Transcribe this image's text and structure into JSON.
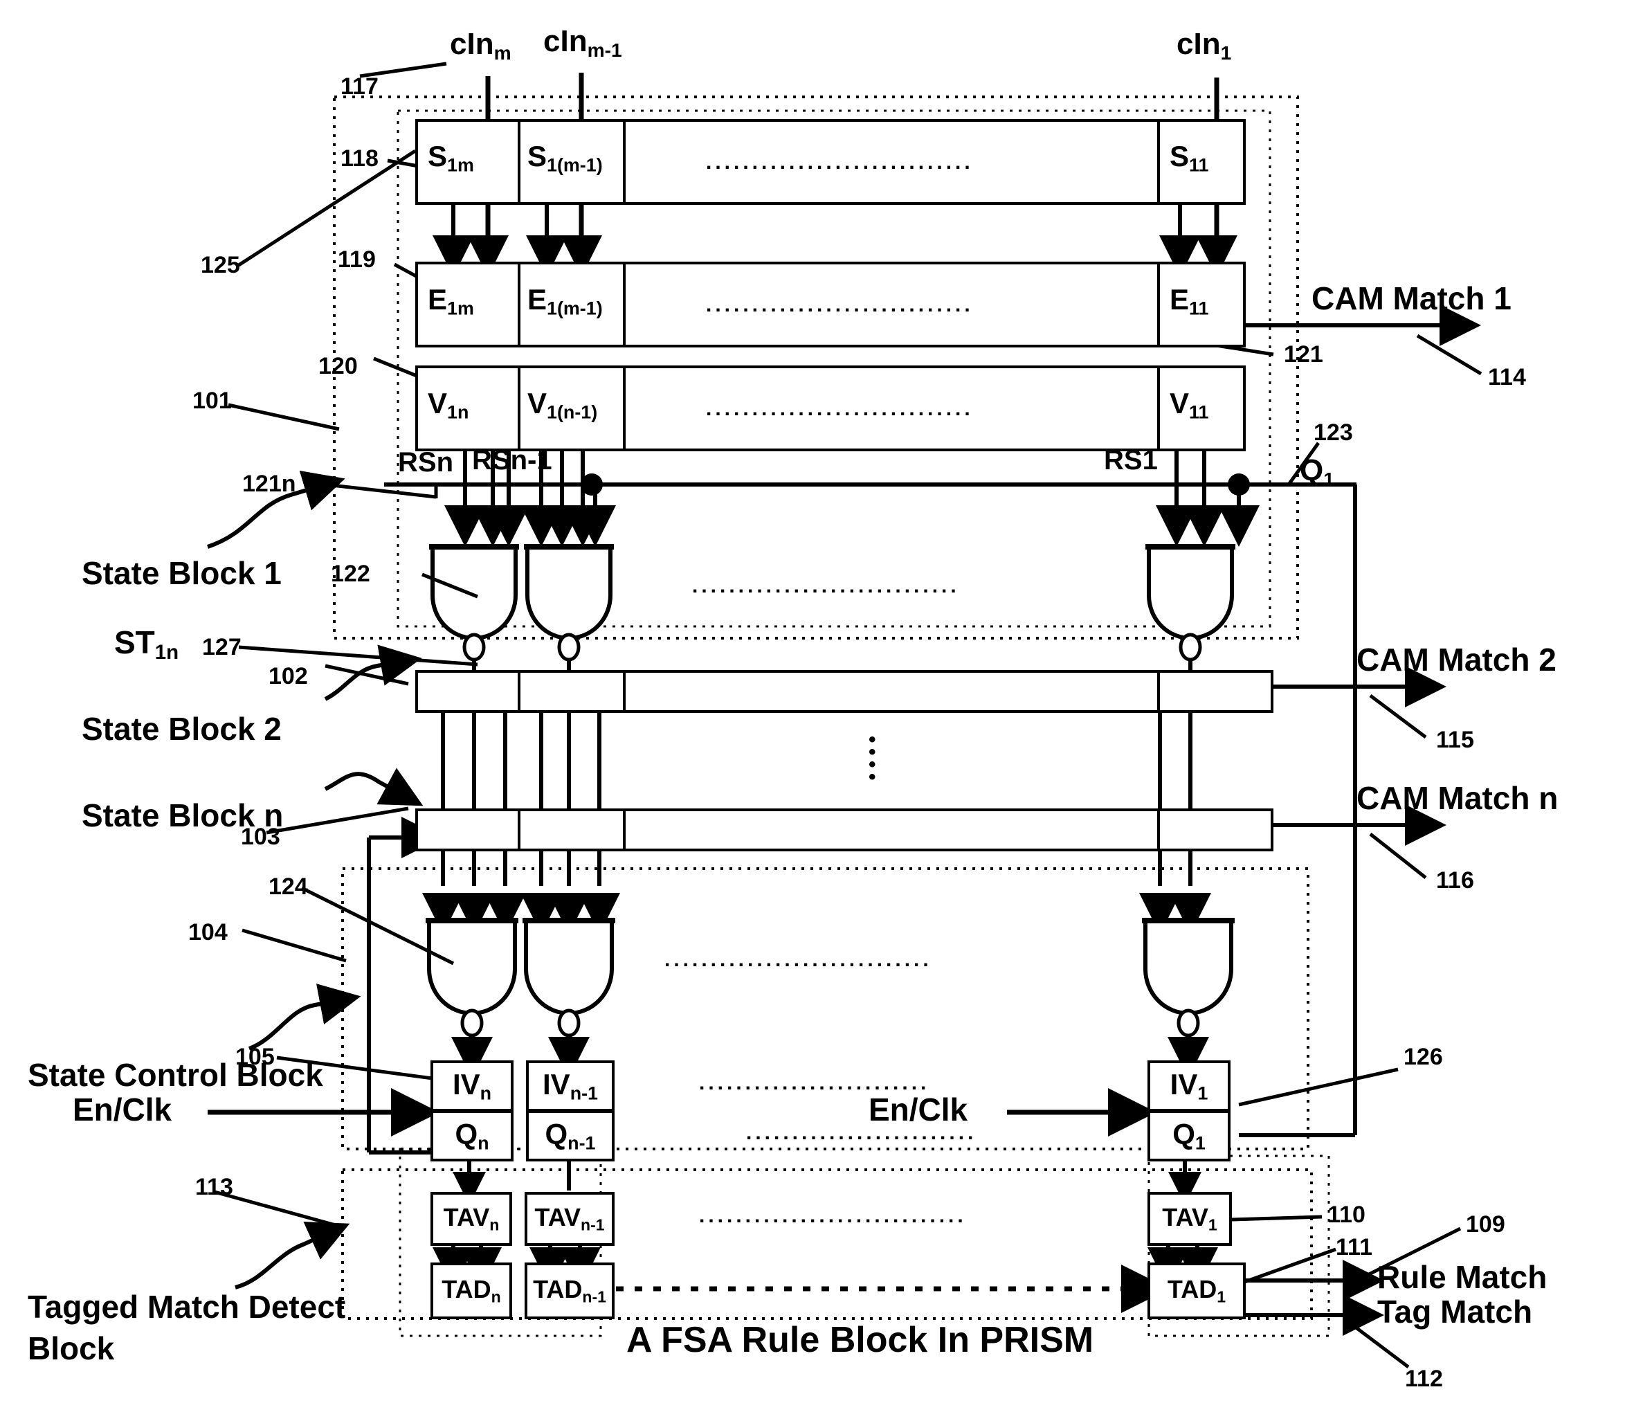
{
  "caption": "A FSA Rule Block In PRISM",
  "inputs": {
    "cin_m": "cIn",
    "cin_m_sub": "m",
    "cin_m1": "cIn",
    "cin_m1_sub": "m-1",
    "cin_1": "cIn",
    "cin_1_sub": "1"
  },
  "s_row": {
    "cells": [
      {
        "base": "S",
        "sub": "1m"
      },
      {
        "base": "S",
        "sub": "1(m-1)"
      },
      {
        "base": "S",
        "sub": "11"
      }
    ],
    "ellipsis": "............................."
  },
  "e_row": {
    "cells": [
      {
        "base": "E",
        "sub": "1m"
      },
      {
        "base": "E",
        "sub": "1(m-1)"
      },
      {
        "base": "E",
        "sub": "11"
      }
    ],
    "ellipsis": "............................."
  },
  "v_row": {
    "cells": [
      {
        "base": "V",
        "sub": "1n"
      },
      {
        "base": "V",
        "sub": "1(n-1)"
      },
      {
        "base": "V",
        "sub": "11"
      }
    ],
    "ellipsis": "............................."
  },
  "rs_labels": {
    "rsn": "RSn",
    "rsn1": "RSn-1",
    "rs1": "RS1"
  },
  "q_feedback": {
    "base": "Q",
    "sub": "1"
  },
  "gate_row_1": {
    "ellipsis": "............................."
  },
  "gate_row_2": {
    "ellipsis": "............................."
  },
  "iv_row": {
    "cells": [
      {
        "base": "IV",
        "sub": "n"
      },
      {
        "base": "IV",
        "sub": "n-1"
      },
      {
        "base": "IV",
        "sub": "1"
      }
    ],
    "ellipsis": "........................."
  },
  "q_row": {
    "cells": [
      {
        "base": "Q",
        "sub": "n"
      },
      {
        "base": "Q",
        "sub": "n-1"
      },
      {
        "base": "Q",
        "sub": "1"
      }
    ],
    "ellipsis": "........................."
  },
  "tav_row": {
    "cells": [
      {
        "base": "TAV",
        "sub": "n"
      },
      {
        "base": "TAV",
        "sub": "n-1"
      },
      {
        "base": "TAV",
        "sub": "1"
      }
    ],
    "ellipsis": "............................."
  },
  "tad_row": {
    "cells": [
      {
        "base": "TAD",
        "sub": "n"
      },
      {
        "base": "TAD",
        "sub": "n-1"
      },
      {
        "base": "TAD",
        "sub": "1"
      }
    ],
    "ellipsis": ". . . . . . . . . . . . . . . . . . . . . . . . ."
  },
  "left_labels": {
    "state_block_1": "State Block 1",
    "state_block_2": "State Block 2",
    "state_block_n": "State Block n",
    "state_control_block": "State Control Block",
    "tagged_match_detect_block_l1": "Tagged Match Detect",
    "tagged_match_detect_block_l2": "Block",
    "st1n_base": "ST",
    "st1n_sub": "1n",
    "enclk_left": "En/Clk",
    "enclk_right": "En/Clk"
  },
  "right_labels": {
    "cam_match_1": "CAM Match 1",
    "cam_match_2": "CAM Match 2",
    "cam_match_n": "CAM Match n",
    "rule_match": "Rule Match",
    "tag_match": "Tag Match"
  },
  "ref_numbers": {
    "n101": "101",
    "n102": "102",
    "n103": "103",
    "n104": "104",
    "n105": "105",
    "n109": "109",
    "n110": "110",
    "n111": "111",
    "n112": "112",
    "n113": "113",
    "n114": "114",
    "n115": "115",
    "n116": "116",
    "n117": "117",
    "n118": "118",
    "n119": "119",
    "n120": "120",
    "n121": "121",
    "n121n": "121n",
    "n122": "122",
    "n123": "123",
    "n124": "124",
    "n125": "125",
    "n126": "126",
    "n127": "127"
  },
  "colors": {
    "ink": "#000000",
    "paper": "#ffffff"
  }
}
